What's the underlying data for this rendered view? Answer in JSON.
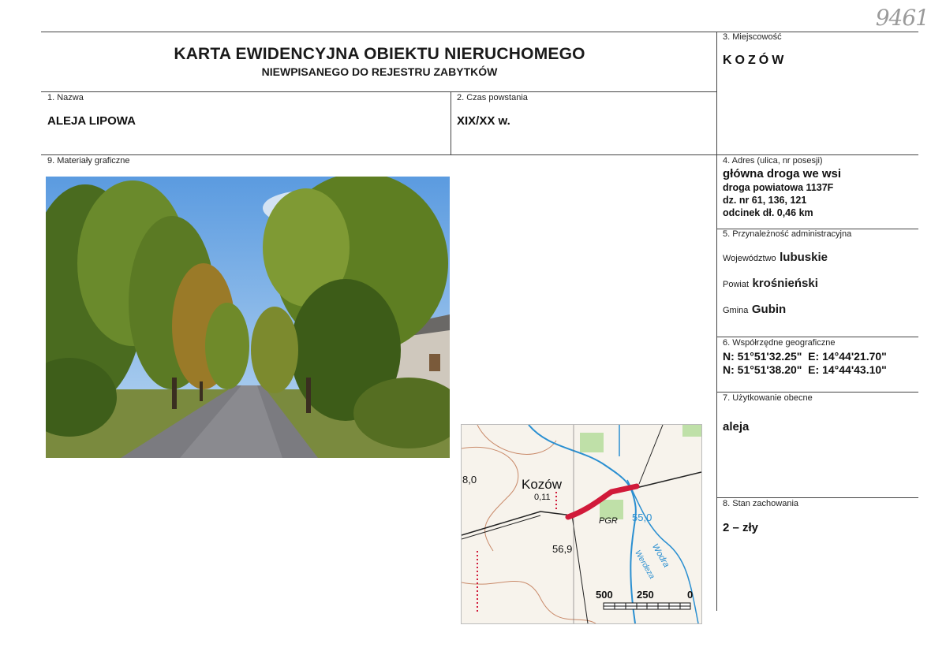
{
  "archive_number": "9461",
  "title": "KARTA EWIDENCYJNA OBIEKTU NIERUCHOMEGO",
  "subtitle": "NIEWPISANEGO DO REJESTRU ZABYTKÓW",
  "fields": {
    "nazwa": {
      "label": "1. Nazwa",
      "value": "ALEJA LIPOWA"
    },
    "czas": {
      "label": "2. Czas powstania",
      "value": "XIX/XX w."
    },
    "miejscowosc": {
      "label": "3. Miejscowość",
      "value": "KOZÓW"
    },
    "adres": {
      "label": "4. Adres (ulica, nr posesji)",
      "line1": "główna droga we wsi",
      "line2": "droga powiatowa 1137F",
      "line3": "dz. nr 61, 136, 121",
      "line4": "odcinek dł. 0,46 km"
    },
    "administracja": {
      "label": "5. Przynależność administracyjna",
      "woj_label": "Województwo",
      "woj_value": "lubuskie",
      "powiat_label": "Powiat",
      "powiat_value": "krośnieński",
      "gmina_label": "Gmina",
      "gmina_value": "Gubin"
    },
    "wspolrzedne": {
      "label": "6. Współrzędne geograficzne",
      "line1": "N: 51°51'32.25\"  E: 14°44'21.70\"",
      "line2": "N: 51°51'38.20\"  E: 14°44'43.10\""
    },
    "uzytkowanie": {
      "label": "7. Użytkowanie obecne",
      "value": "aleja"
    },
    "stan": {
      "label": "8. Stan zachowania",
      "value": "2 – zły"
    },
    "materialy": {
      "label": "9. Materiały graficzne"
    }
  },
  "map": {
    "place": "Kozów",
    "elev1": "8,0",
    "elev2": "0,11",
    "elev3": "56,9",
    "elev4": "55,0",
    "pgr": "PGR",
    "river1": "Wodra",
    "river2": "Werdeza",
    "scale_500": "500",
    "scale_250": "250",
    "scale_0": "0",
    "colors": {
      "road_highlight": "#d11a3a",
      "water": "#2a8fd1",
      "contour": "#c98a6a"
    }
  }
}
